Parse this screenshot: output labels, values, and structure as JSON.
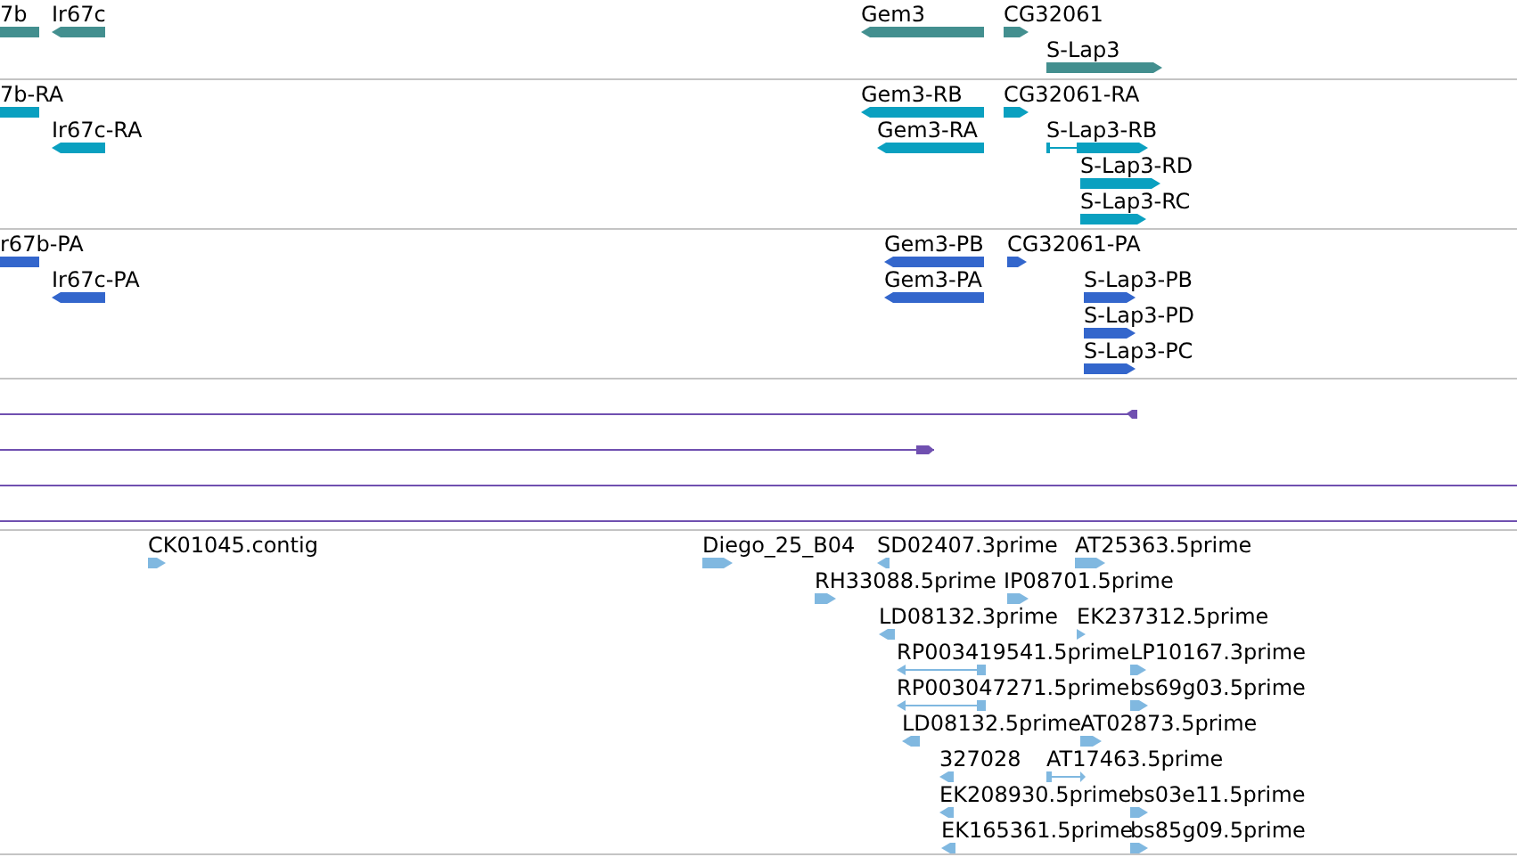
{
  "tracks": [
    {
      "kind": "features",
      "color": "#438f8f",
      "features": [
        {
          "label": "7b",
          "forward": false,
          "reverse": false,
          "kind": "block"
        },
        {
          "label": "Ir67c",
          "forward": false,
          "reverse": true,
          "kind": "block"
        },
        {
          "label": "Gem3",
          "forward": false,
          "reverse": true,
          "kind": "block"
        },
        {
          "label": "CG32061",
          "forward": true,
          "reverse": false,
          "kind": "block"
        },
        {
          "label": "S-Lap3",
          "forward": true,
          "reverse": false,
          "kind": "block"
        }
      ]
    },
    {
      "kind": "features",
      "color": "#0aa0c0",
      "features": [
        {
          "label": "7b-RA",
          "forward": false,
          "reverse": false,
          "kind": "block"
        },
        {
          "label": "Ir67c-RA",
          "forward": false,
          "reverse": true,
          "kind": "block"
        },
        {
          "label": "Gem3-RB",
          "forward": false,
          "reverse": true,
          "kind": "block"
        },
        {
          "label": "CG32061-RA",
          "forward": true,
          "reverse": false,
          "kind": "block"
        },
        {
          "label": "Gem3-RA",
          "forward": false,
          "reverse": true,
          "kind": "block"
        },
        {
          "label": "S-Lap3-RB",
          "forward": true,
          "reverse": false,
          "kind": "spliced"
        },
        {
          "label": "S-Lap3-RD",
          "forward": true,
          "reverse": false,
          "kind": "block"
        },
        {
          "label": "S-Lap3-RC",
          "forward": true,
          "reverse": false,
          "kind": "block"
        }
      ]
    },
    {
      "kind": "features",
      "color": "#3366cc",
      "features": [
        {
          "label": "r67b-PA",
          "forward": false,
          "reverse": false,
          "kind": "block"
        },
        {
          "label": "Ir67c-PA",
          "forward": false,
          "reverse": true,
          "kind": "block"
        },
        {
          "label": "Gem3-PB",
          "forward": false,
          "reverse": true,
          "kind": "block"
        },
        {
          "label": "CG32061-PA",
          "forward": true,
          "reverse": false,
          "kind": "block"
        },
        {
          "label": "Gem3-PA",
          "forward": false,
          "reverse": true,
          "kind": "block"
        },
        {
          "label": "S-Lap3-PB",
          "forward": true,
          "reverse": false,
          "kind": "block"
        },
        {
          "label": "S-Lap3-PD",
          "forward": true,
          "reverse": false,
          "kind": "block"
        },
        {
          "label": "S-Lap3-PC",
          "forward": true,
          "reverse": false,
          "kind": "block"
        }
      ]
    },
    {
      "kind": "lines",
      "color": "#7050b0",
      "features": [
        {
          "forward": false,
          "reverse": true,
          "kind": "line"
        },
        {
          "forward": true,
          "reverse": false,
          "kind": "line"
        },
        {
          "forward": false,
          "reverse": false,
          "kind": "line"
        },
        {
          "forward": false,
          "reverse": false,
          "kind": "line"
        }
      ]
    },
    {
      "kind": "features",
      "color": "#80b8e0",
      "features": [
        {
          "label": "CK01045.contig",
          "forward": true,
          "reverse": false,
          "kind": "block"
        },
        {
          "label": "Diego_25_B04",
          "forward": true,
          "reverse": false,
          "kind": "block"
        },
        {
          "label": "SD02407.3prime",
          "forward": false,
          "reverse": true,
          "kind": "block"
        },
        {
          "label": "AT25363.5prime",
          "forward": true,
          "reverse": false,
          "kind": "block"
        },
        {
          "label": "RH33088.5prime",
          "forward": true,
          "reverse": false,
          "kind": "block"
        },
        {
          "label": "IP08701.5prime",
          "forward": true,
          "reverse": false,
          "kind": "block"
        },
        {
          "label": "LD08132.3prime",
          "forward": false,
          "reverse": true,
          "kind": "block"
        },
        {
          "label": "EK237312.5prime",
          "forward": true,
          "reverse": false,
          "kind": "block"
        },
        {
          "label": "RP003419541.5prime",
          "forward": false,
          "reverse": true,
          "kind": "spliced"
        },
        {
          "label": "LP10167.3prime",
          "forward": true,
          "reverse": false,
          "kind": "block"
        },
        {
          "label": "RP003047271.5prime",
          "forward": false,
          "reverse": true,
          "kind": "spliced"
        },
        {
          "label": "bs69g03.5prime",
          "forward": true,
          "reverse": false,
          "kind": "block"
        },
        {
          "label": "LD08132.5prime",
          "forward": false,
          "reverse": true,
          "kind": "block"
        },
        {
          "label": "AT02873.5prime",
          "forward": true,
          "reverse": false,
          "kind": "block"
        },
        {
          "label": "327028",
          "forward": false,
          "reverse": true,
          "kind": "block"
        },
        {
          "label": "AT17463.5prime",
          "forward": true,
          "reverse": false,
          "kind": "spliced"
        },
        {
          "label": "EK208930.5prime",
          "forward": false,
          "reverse": true,
          "kind": "block"
        },
        {
          "label": "bs03e11.5prime",
          "forward": true,
          "reverse": false,
          "kind": "block"
        },
        {
          "label": "EK165361.5prime",
          "forward": false,
          "reverse": true,
          "kind": "block"
        },
        {
          "label": "bs85g09.5prime",
          "forward": true,
          "reverse": false,
          "kind": "block"
        }
      ]
    }
  ]
}
